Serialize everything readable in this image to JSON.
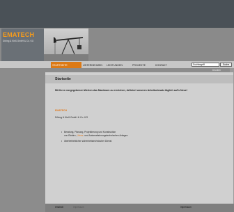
{
  "brand": {
    "logo": "EMATECH",
    "subtitle": "Döring & Kieß GmbH & Co. KG",
    "accent_color": "#f59b1c"
  },
  "nav": {
    "items": [
      {
        "label": "STARTSEITE",
        "active": true
      },
      {
        "label": "UNTERNEHMEN",
        "active": false
      },
      {
        "label": "LEISTUNGEN",
        "active": false
      },
      {
        "label": "PROJEKTE",
        "active": false
      },
      {
        "label": "KONTAKT",
        "active": false
      }
    ]
  },
  "search": {
    "value": "Suchbegriff",
    "button": "Suche"
  },
  "page": {
    "drucken": "Drucken",
    "title": "Startseite",
    "intro": "Mit Ihren vorgegebenen Werten das Maximum zu erreichen, definiert unseren Arbeitseinsatz täglich auf's Neue!",
    "company": "EMATECH",
    "company_sub": "Döring & Kieß GmbH & Co. KG",
    "list": [
      {
        "line1": "Beratung, Planung, Projektierung und Konstruktion",
        "line2_a": "von Elektro-, ",
        "line2_b": "Mess",
        "line2_c": "- und Automatisierungstechnischen Anlagen"
      },
      {
        "line1": "überbetrieblicher sicherheitstechnischer Dienst"
      }
    ]
  },
  "footer": {
    "left": "ematech",
    "middle": "Impressum",
    "right": "Impressum"
  }
}
